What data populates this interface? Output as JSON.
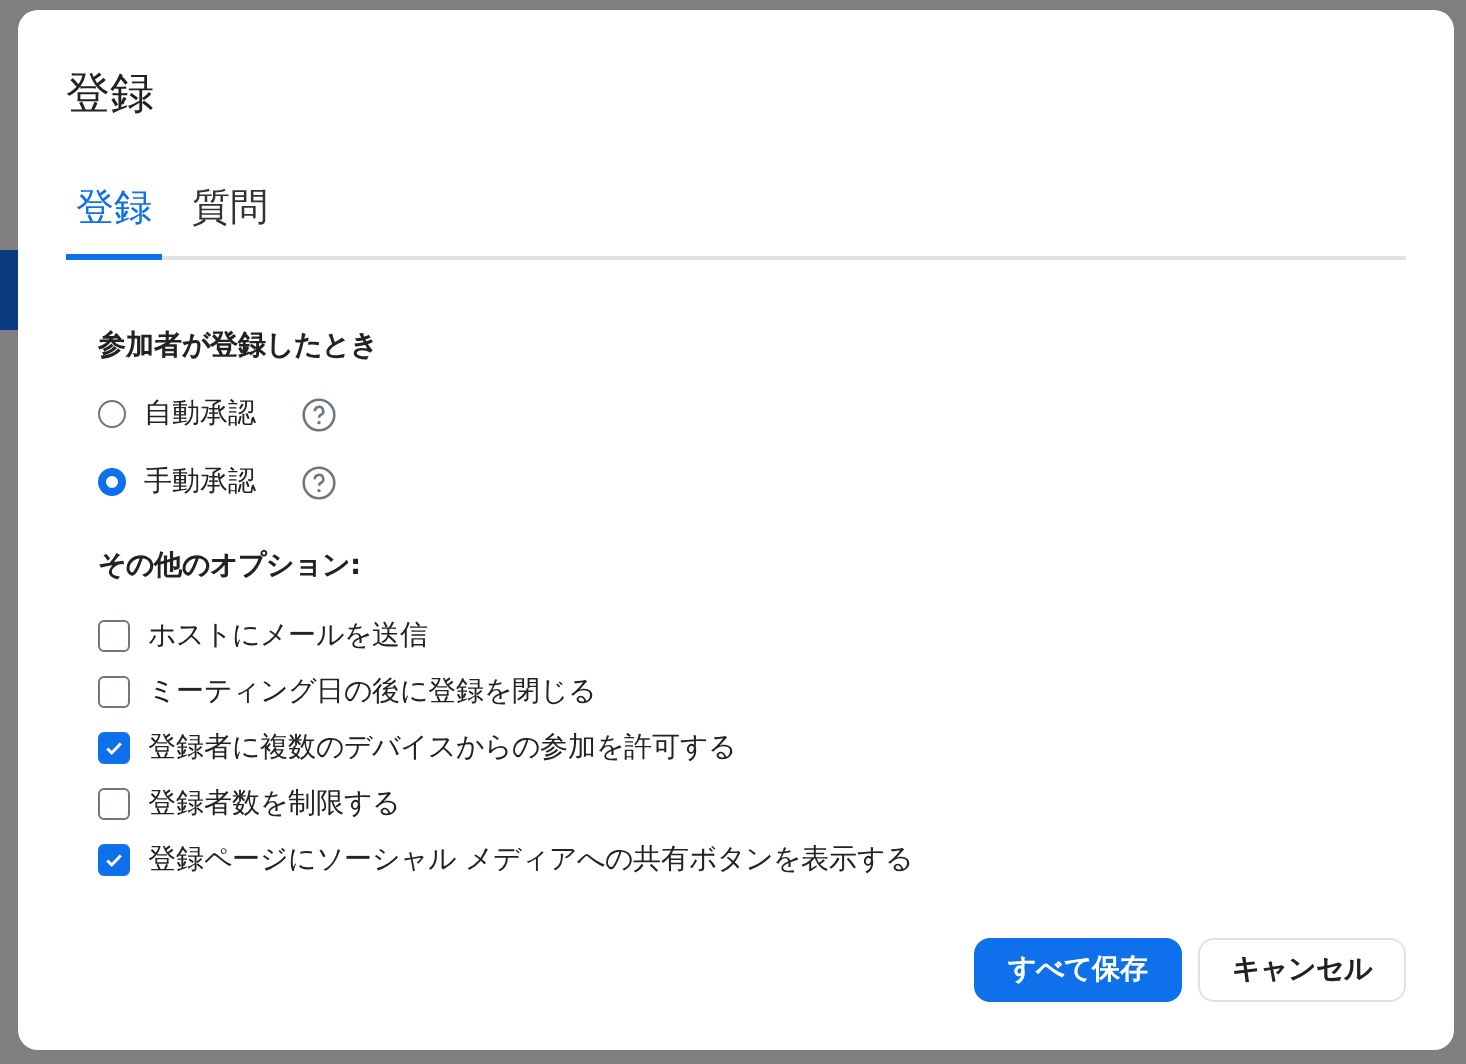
{
  "dialog": {
    "title": "登録"
  },
  "tabs": [
    {
      "label": "登録",
      "selected": true
    },
    {
      "label": "質問",
      "selected": false
    }
  ],
  "approval": {
    "heading": "参加者が登録したとき",
    "options": [
      {
        "label": "自動承認",
        "selected": false,
        "help": true
      },
      {
        "label": "手動承認",
        "selected": true,
        "help": true
      }
    ]
  },
  "other_options": {
    "heading": "その他のオプション:",
    "items": [
      {
        "label": "ホストにメールを送信",
        "checked": false
      },
      {
        "label": "ミーティング日の後に登録を閉じる",
        "checked": false
      },
      {
        "label": "登録者に複数のデバイスからの参加を許可する",
        "checked": true
      },
      {
        "label": "登録者数を制限する",
        "checked": false
      },
      {
        "label": "登録ページにソーシャル メディアへの共有ボタンを表示する",
        "checked": true
      }
    ]
  },
  "buttons": [
    {
      "label": "すべて保存",
      "kind": "primary"
    },
    {
      "label": "キャンセル",
      "kind": "secondary"
    }
  ]
}
